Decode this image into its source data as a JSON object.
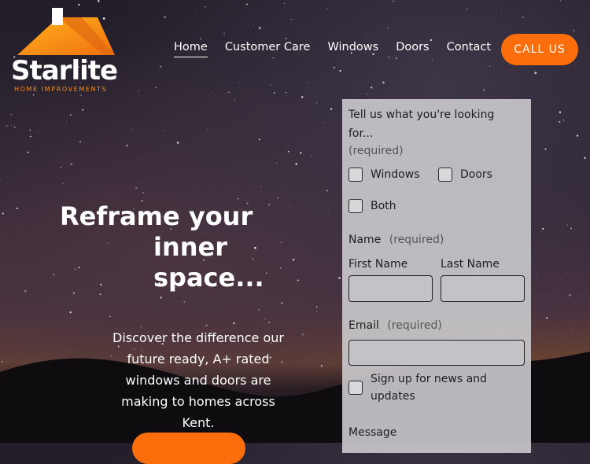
{
  "brand": {
    "name": "Starlite",
    "tagline": "HOME IMPROVEMENTS"
  },
  "nav": {
    "items": [
      {
        "label": "Home"
      },
      {
        "label": "Customer Care"
      },
      {
        "label": "Windows"
      },
      {
        "label": "Doors"
      },
      {
        "label": "Contact"
      }
    ],
    "cta": "CALL US"
  },
  "hero": {
    "title_lines": [
      "Reframe your",
      "inner",
      "space..."
    ],
    "description": "Discover the difference our future ready, A+ rated windows and doors are making to homes across Kent."
  },
  "form": {
    "question": "Tell us what you're looking for...",
    "required": "(required)",
    "options": [
      "Windows",
      "Doors",
      "Both"
    ],
    "name_label": "Name",
    "first_name": "First Name",
    "last_name": "Last Name",
    "email_label": "Email",
    "newsletter": "Sign up for news and updates",
    "message_label": "Message"
  },
  "colors": {
    "accent": "#fc6e0c",
    "logo_orange": "#f5901e"
  }
}
